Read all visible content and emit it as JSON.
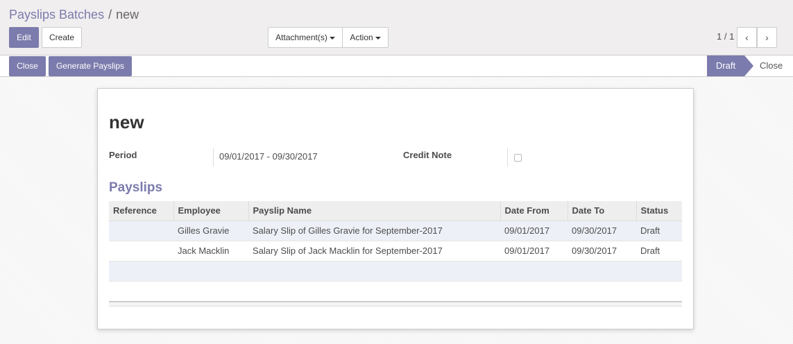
{
  "breadcrumb": {
    "parent": "Payslips Batches",
    "separator": "/",
    "current": "new"
  },
  "toolbar": {
    "edit": "Edit",
    "create": "Create",
    "attachments": "Attachment(s)",
    "action": "Action"
  },
  "pager": {
    "value": "1 / 1",
    "prev": "‹",
    "next": "›"
  },
  "statusbar": {
    "close_button": "Close",
    "generate_button": "Generate Payslips",
    "stages": [
      "Draft",
      "Close"
    ],
    "active_stage": "Draft"
  },
  "form": {
    "title": "new",
    "period_label": "Period",
    "period_value": "09/01/2017 - 09/30/2017",
    "credit_note_label": "Credit Note",
    "credit_note_checked": false,
    "section_title": "Payslips",
    "columns": [
      "Reference",
      "Employee",
      "Payslip Name",
      "Date From",
      "Date To",
      "Status"
    ],
    "rows": [
      {
        "reference": "",
        "employee": "Gilles Gravie",
        "name": "Salary Slip of Gilles Gravie for September-2017",
        "date_from": "09/01/2017",
        "date_to": "09/30/2017",
        "status": "Draft"
      },
      {
        "reference": "",
        "employee": "Jack Macklin",
        "name": "Salary Slip of Jack Macklin for September-2017",
        "date_from": "09/01/2017",
        "date_to": "09/30/2017",
        "status": "Draft"
      }
    ]
  },
  "colors": {
    "primary": "#7c7bad",
    "text": "#4c4c4c"
  }
}
